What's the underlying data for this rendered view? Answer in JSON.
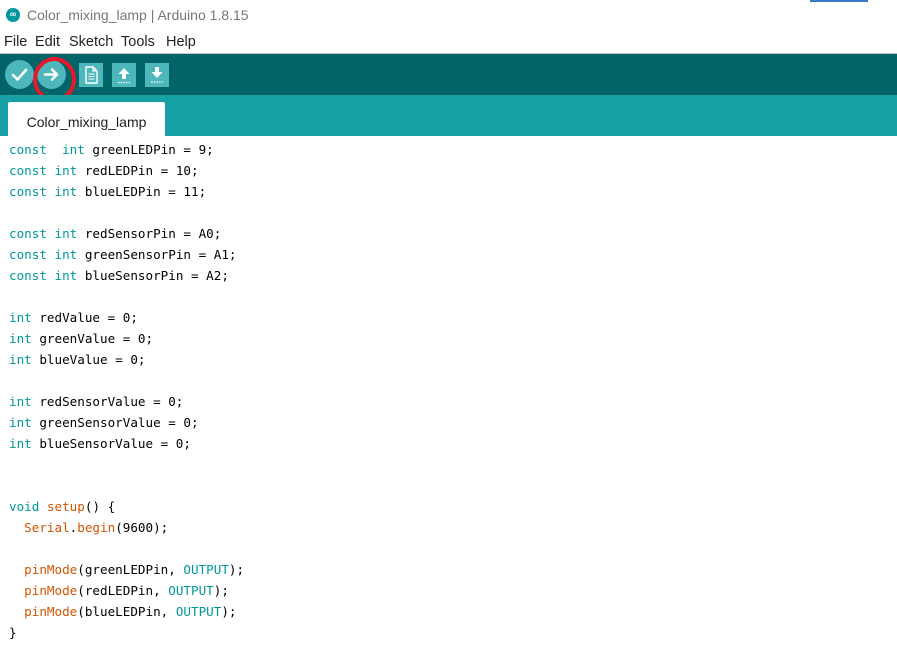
{
  "window": {
    "title": "Color_mixing_lamp | Arduino 1.8.15",
    "app_icon": "arduino-infinity-icon"
  },
  "menu": [
    "File",
    "Edit",
    "Sketch",
    "Tools",
    "Help"
  ],
  "toolbar": {
    "buttons": [
      {
        "name": "verify",
        "icon": "checkmark-icon"
      },
      {
        "name": "upload",
        "icon": "arrow-right-icon"
      },
      {
        "name": "new",
        "icon": "document-icon"
      },
      {
        "name": "open",
        "icon": "arrow-up-icon"
      },
      {
        "name": "save",
        "icon": "arrow-down-icon"
      }
    ],
    "highlighted_button": "upload",
    "highlight_color": "#e8182b"
  },
  "tabs": [
    {
      "label": "Color_mixing_lamp",
      "active": true
    }
  ],
  "colors": {
    "toolbar_bg": "#006468",
    "tabstrip_bg": "#17a1a5",
    "button_bg": "#4db7bb",
    "keyword": "#00979c",
    "function": "#d35400"
  },
  "code": [
    [
      [
        "kw",
        "const"
      ],
      [
        "",
        "  "
      ],
      [
        "kw",
        "int"
      ],
      [
        "",
        " greenLEDPin = 9;"
      ]
    ],
    [
      [
        "kw",
        "const"
      ],
      [
        "",
        " "
      ],
      [
        "kw",
        "int"
      ],
      [
        "",
        " redLEDPin = 10;"
      ]
    ],
    [
      [
        "kw",
        "const"
      ],
      [
        "",
        " "
      ],
      [
        "kw",
        "int"
      ],
      [
        "",
        " blueLEDPin = 11;"
      ]
    ],
    [],
    [
      [
        "kw",
        "const"
      ],
      [
        "",
        " "
      ],
      [
        "kw",
        "int"
      ],
      [
        "",
        " redSensorPin = A0;"
      ]
    ],
    [
      [
        "kw",
        "const"
      ],
      [
        "",
        " "
      ],
      [
        "kw",
        "int"
      ],
      [
        "",
        " greenSensorPin = A1;"
      ]
    ],
    [
      [
        "kw",
        "const"
      ],
      [
        "",
        " "
      ],
      [
        "kw",
        "int"
      ],
      [
        "",
        " blueSensorPin = A2;"
      ]
    ],
    [],
    [
      [
        "kw",
        "int"
      ],
      [
        "",
        " redValue = 0;"
      ]
    ],
    [
      [
        "kw",
        "int"
      ],
      [
        "",
        " greenValue = 0;"
      ]
    ],
    [
      [
        "kw",
        "int"
      ],
      [
        "",
        " blueValue = 0;"
      ]
    ],
    [],
    [
      [
        "kw",
        "int"
      ],
      [
        "",
        " redSensorValue = 0;"
      ]
    ],
    [
      [
        "kw",
        "int"
      ],
      [
        "",
        " greenSensorValue = 0;"
      ]
    ],
    [
      [
        "kw",
        "int"
      ],
      [
        "",
        " blueSensorValue = 0;"
      ]
    ],
    [],
    [],
    [
      [
        "kw",
        "void"
      ],
      [
        "",
        " "
      ],
      [
        "fn",
        "setup"
      ],
      [
        "",
        "() {"
      ]
    ],
    [
      [
        "",
        "  "
      ],
      [
        "fn",
        "Serial"
      ],
      [
        "",
        "."
      ],
      [
        "fn",
        "begin"
      ],
      [
        "",
        "(9600);"
      ]
    ],
    [],
    [
      [
        "",
        "  "
      ],
      [
        "fn",
        "pinMode"
      ],
      [
        "",
        "(greenLEDPin, "
      ],
      [
        "const",
        "OUTPUT"
      ],
      [
        "",
        ");"
      ]
    ],
    [
      [
        "",
        "  "
      ],
      [
        "fn",
        "pinMode"
      ],
      [
        "",
        "(redLEDPin, "
      ],
      [
        "const",
        "OUTPUT"
      ],
      [
        "",
        ");"
      ]
    ],
    [
      [
        "",
        "  "
      ],
      [
        "fn",
        "pinMode"
      ],
      [
        "",
        "(blueLEDPin, "
      ],
      [
        "const",
        "OUTPUT"
      ],
      [
        "",
        ");"
      ]
    ],
    [
      [
        "",
        "}"
      ]
    ]
  ]
}
